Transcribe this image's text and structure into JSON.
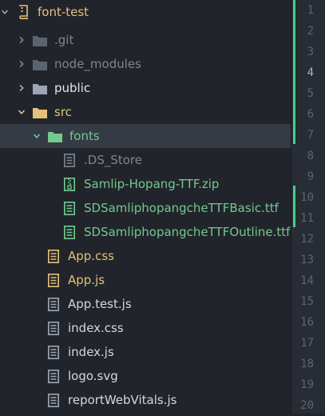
{
  "tree": {
    "root": {
      "label": "font-test"
    },
    "items": [
      {
        "label": ".git"
      },
      {
        "label": "node_modules"
      },
      {
        "label": "public"
      },
      {
        "label": "src"
      },
      {
        "label": "fonts"
      },
      {
        "label": ".DS_Store"
      },
      {
        "label": "Samlip-Hopang-TTF.zip"
      },
      {
        "label": "SDSamliphopangcheTTFBasic.ttf"
      },
      {
        "label": "SDSamliphopangcheTTFOutline.ttf"
      },
      {
        "label": "App.css"
      },
      {
        "label": "App.js"
      },
      {
        "label": "App.test.js"
      },
      {
        "label": "index.css"
      },
      {
        "label": "index.js"
      },
      {
        "label": "logo.svg"
      },
      {
        "label": "reportWebVitals.js"
      }
    ]
  },
  "gutter": {
    "lines": [
      "1",
      "2",
      "3",
      "4",
      "5",
      "6",
      "7",
      "8",
      "9",
      "10",
      "11",
      "12",
      "13",
      "14",
      "15",
      "16",
      "17",
      "18",
      "19",
      "20"
    ],
    "current_line": "4"
  },
  "colors": {
    "modified_green": "#73c990",
    "modified_yellow": "#e5c07b",
    "ignored": "#7f8590",
    "selection": "#353b45",
    "folder_open": "#73c990"
  }
}
